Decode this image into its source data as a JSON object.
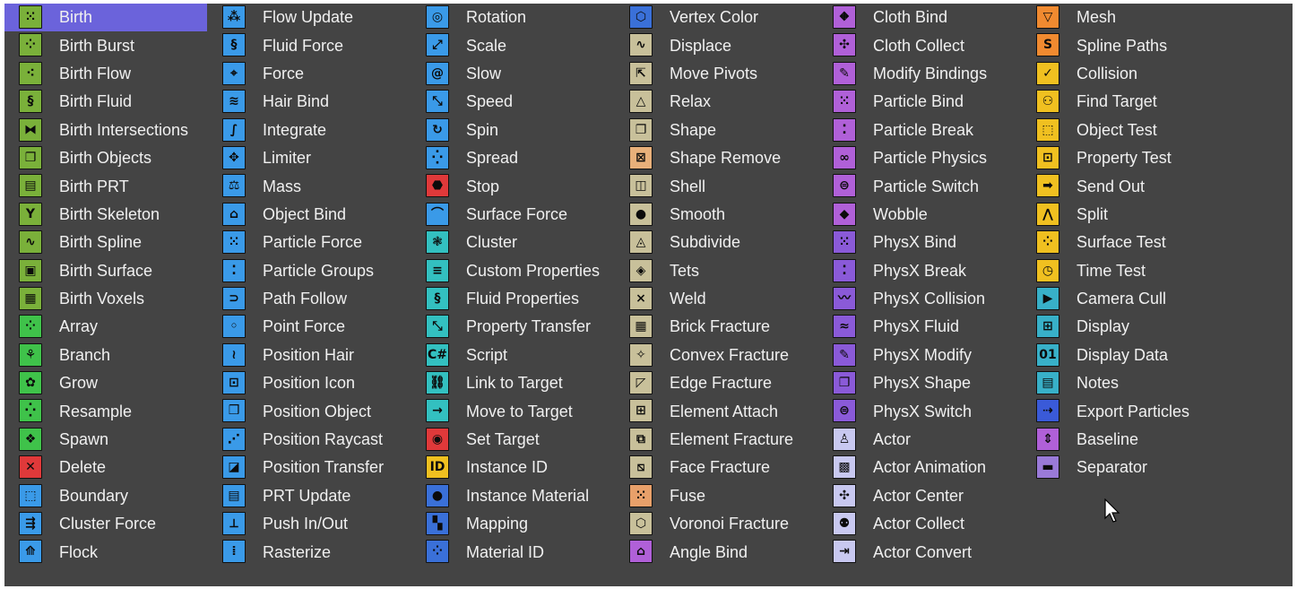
{
  "colors": {
    "panel_bg": "#444444",
    "selection": "#6b63db",
    "text": "#f0f0f0"
  },
  "columns": [
    {
      "color": "#7ab03a",
      "items": [
        {
          "label": "Birth",
          "icon": "birth-icon",
          "glyph": "⁙",
          "selected": true
        },
        {
          "label": "Birth Burst",
          "icon": "birth-burst-icon",
          "glyph": "⁘"
        },
        {
          "label": "Birth Flow",
          "icon": "birth-flow-icon",
          "glyph": "⁖"
        },
        {
          "label": "Birth Fluid",
          "icon": "birth-fluid-icon",
          "glyph": "§"
        },
        {
          "label": "Birth Intersections",
          "icon": "birth-intersections-icon",
          "glyph": "⧓"
        },
        {
          "label": "Birth Objects",
          "icon": "birth-objects-icon",
          "glyph": "❐"
        },
        {
          "label": "Birth PRT",
          "icon": "birth-prt-icon",
          "glyph": "▤"
        },
        {
          "label": "Birth Skeleton",
          "icon": "birth-skeleton-icon",
          "glyph": "Y"
        },
        {
          "label": "Birth Spline",
          "icon": "birth-spline-icon",
          "glyph": "∿"
        },
        {
          "label": "Birth Surface",
          "icon": "birth-surface-icon",
          "glyph": "▣"
        },
        {
          "label": "Birth Voxels",
          "icon": "birth-voxels-icon",
          "glyph": "▦"
        },
        {
          "label": "Array",
          "icon": "array-icon",
          "glyph": "⁘",
          "color": "#3fc24a"
        },
        {
          "label": "Branch",
          "icon": "branch-icon",
          "glyph": "⚘",
          "color": "#3fc24a"
        },
        {
          "label": "Grow",
          "icon": "grow-icon",
          "glyph": "✿",
          "color": "#3fc24a"
        },
        {
          "label": "Resample",
          "icon": "resample-icon",
          "glyph": "⁛",
          "color": "#3fc24a"
        },
        {
          "label": "Spawn",
          "icon": "spawn-icon",
          "glyph": "❖",
          "color": "#3fc24a"
        },
        {
          "label": "Delete",
          "icon": "delete-icon",
          "glyph": "✕",
          "color": "#e0393a"
        },
        {
          "label": "Boundary",
          "icon": "boundary-icon",
          "glyph": "⬚",
          "color": "#3a9ae8"
        },
        {
          "label": "Cluster Force",
          "icon": "cluster-force-icon",
          "glyph": "⇶",
          "color": "#3a9ae8"
        },
        {
          "label": "Flock",
          "icon": "flock-icon",
          "glyph": "⟰",
          "color": "#3a9ae8"
        }
      ]
    },
    {
      "color": "#3a9ae8",
      "items": [
        {
          "label": "Flow Update",
          "icon": "flow-update-icon",
          "glyph": "⁂"
        },
        {
          "label": "Fluid Force",
          "icon": "fluid-force-icon",
          "glyph": "§"
        },
        {
          "label": "Force",
          "icon": "force-icon",
          "glyph": "⌖"
        },
        {
          "label": "Hair Bind",
          "icon": "hair-bind-icon",
          "glyph": "≋"
        },
        {
          "label": "Integrate",
          "icon": "integrate-icon",
          "glyph": "∫"
        },
        {
          "label": "Limiter",
          "icon": "limiter-icon",
          "glyph": "✥"
        },
        {
          "label": "Mass",
          "icon": "mass-icon",
          "glyph": "⚖"
        },
        {
          "label": "Object Bind",
          "icon": "object-bind-icon",
          "glyph": "⌂"
        },
        {
          "label": "Particle Force",
          "icon": "particle-force-icon",
          "glyph": "⁙"
        },
        {
          "label": "Particle Groups",
          "icon": "particle-groups-icon",
          "glyph": "⁚"
        },
        {
          "label": "Path Follow",
          "icon": "path-follow-icon",
          "glyph": "⊃"
        },
        {
          "label": "Point Force",
          "icon": "point-force-icon",
          "glyph": "◦"
        },
        {
          "label": "Position Hair",
          "icon": "position-hair-icon",
          "glyph": "≀"
        },
        {
          "label": "Position Icon",
          "icon": "position-icon-icon",
          "glyph": "⊡"
        },
        {
          "label": "Position Object",
          "icon": "position-object-icon",
          "glyph": "❒"
        },
        {
          "label": "Position Raycast",
          "icon": "position-raycast-icon",
          "glyph": "⋰"
        },
        {
          "label": "Position Transfer",
          "icon": "position-transfer-icon",
          "glyph": "◪"
        },
        {
          "label": "PRT Update",
          "icon": "prt-update-icon",
          "glyph": "▤"
        },
        {
          "label": "Push In/Out",
          "icon": "push-in-out-icon",
          "glyph": "⟂"
        },
        {
          "label": "Rasterize",
          "icon": "rasterize-icon",
          "glyph": "⁞"
        }
      ]
    },
    {
      "color": "#3a9ae8",
      "items": [
        {
          "label": "Rotation",
          "icon": "rotation-icon",
          "glyph": "◎"
        },
        {
          "label": "Scale",
          "icon": "scale-icon",
          "glyph": "⤢"
        },
        {
          "label": "Slow",
          "icon": "slow-icon",
          "glyph": "@"
        },
        {
          "label": "Speed",
          "icon": "speed-icon",
          "glyph": "⤡"
        },
        {
          "label": "Spin",
          "icon": "spin-icon",
          "glyph": "↻"
        },
        {
          "label": "Spread",
          "icon": "spread-icon",
          "glyph": "⁛"
        },
        {
          "label": "Stop",
          "icon": "stop-icon",
          "glyph": "⬣",
          "color": "#e0393a"
        },
        {
          "label": "Surface Force",
          "icon": "surface-force-icon",
          "glyph": "⌒"
        },
        {
          "label": "Cluster",
          "icon": "cluster-icon",
          "glyph": "❃",
          "color": "#33c0c0"
        },
        {
          "label": "Custom Properties",
          "icon": "custom-properties-icon",
          "glyph": "≡",
          "color": "#33c0c0"
        },
        {
          "label": "Fluid Properties",
          "icon": "fluid-properties-icon",
          "glyph": "§",
          "color": "#33c0c0"
        },
        {
          "label": "Property Transfer",
          "icon": "property-transfer-icon",
          "glyph": "⤡",
          "color": "#33c0c0"
        },
        {
          "label": "Script",
          "icon": "script-icon",
          "glyph": "C#",
          "color": "#33c0c0"
        },
        {
          "label": "Link to Target",
          "icon": "link-to-target-icon",
          "glyph": "⛓",
          "color": "#33c0c0"
        },
        {
          "label": "Move to Target",
          "icon": "move-to-target-icon",
          "glyph": "→",
          "color": "#33c0c0"
        },
        {
          "label": "Set Target",
          "icon": "set-target-icon",
          "glyph": "◉",
          "color": "#e0393a"
        },
        {
          "label": "Instance ID",
          "icon": "instance-id-icon",
          "glyph": "ID",
          "color": "#f0c020"
        },
        {
          "label": "Instance Material",
          "icon": "instance-material-icon",
          "glyph": "●",
          "color": "#3a70d8"
        },
        {
          "label": "Mapping",
          "icon": "mapping-icon",
          "glyph": "▚",
          "color": "#3a70d8"
        },
        {
          "label": "Material ID",
          "icon": "material-id-icon",
          "glyph": "⁘",
          "color": "#3a70d8"
        }
      ]
    },
    {
      "color": "#c8c09a",
      "items": [
        {
          "label": "Vertex Color",
          "icon": "vertex-color-icon",
          "glyph": "⬡",
          "color": "#3a70d8"
        },
        {
          "label": "Displace",
          "icon": "displace-icon",
          "glyph": "∿"
        },
        {
          "label": "Move Pivots",
          "icon": "move-pivots-icon",
          "glyph": "⇱"
        },
        {
          "label": "Relax",
          "icon": "relax-icon",
          "glyph": "△"
        },
        {
          "label": "Shape",
          "icon": "shape-icon",
          "glyph": "❐"
        },
        {
          "label": "Shape Remove",
          "icon": "shape-remove-icon",
          "glyph": "⊠",
          "color": "#e8b07a"
        },
        {
          "label": "Shell",
          "icon": "shell-icon",
          "glyph": "◫"
        },
        {
          "label": "Smooth",
          "icon": "smooth-icon",
          "glyph": "●"
        },
        {
          "label": "Subdivide",
          "icon": "subdivide-icon",
          "glyph": "◬"
        },
        {
          "label": "Tets",
          "icon": "tets-icon",
          "glyph": "◈"
        },
        {
          "label": "Weld",
          "icon": "weld-icon",
          "glyph": "⨯"
        },
        {
          "label": "Brick Fracture",
          "icon": "brick-fracture-icon",
          "glyph": "▦"
        },
        {
          "label": "Convex Fracture",
          "icon": "convex-fracture-icon",
          "glyph": "✧"
        },
        {
          "label": "Edge Fracture",
          "icon": "edge-fracture-icon",
          "glyph": "◸"
        },
        {
          "label": "Element Attach",
          "icon": "element-attach-icon",
          "glyph": "⊞"
        },
        {
          "label": "Element Fracture",
          "icon": "element-fracture-icon",
          "glyph": "⧉"
        },
        {
          "label": "Face Fracture",
          "icon": "face-fracture-icon",
          "glyph": "⧅"
        },
        {
          "label": "Fuse",
          "icon": "fuse-icon",
          "glyph": "⁙",
          "color": "#e8a06a"
        },
        {
          "label": "Voronoi Fracture",
          "icon": "voronoi-fracture-icon",
          "glyph": "⬡"
        },
        {
          "label": "Angle Bind",
          "icon": "angle-bind-icon",
          "glyph": "⌂",
          "color": "#b060d8"
        }
      ]
    },
    {
      "color": "#b060d8",
      "items": [
        {
          "label": "Cloth Bind",
          "icon": "cloth-bind-icon",
          "glyph": "⛖"
        },
        {
          "label": "Cloth Collect",
          "icon": "cloth-collect-icon",
          "glyph": "✣"
        },
        {
          "label": "Modify Bindings",
          "icon": "modify-bindings-icon",
          "glyph": "✎"
        },
        {
          "label": "Particle Bind",
          "icon": "particle-bind-icon",
          "glyph": "⁙"
        },
        {
          "label": "Particle Break",
          "icon": "particle-break-icon",
          "glyph": "⁚"
        },
        {
          "label": "Particle Physics",
          "icon": "particle-physics-icon",
          "glyph": "∞"
        },
        {
          "label": "Particle Switch",
          "icon": "particle-switch-icon",
          "glyph": "⊜"
        },
        {
          "label": "Wobble",
          "icon": "wobble-icon",
          "glyph": "◆"
        },
        {
          "label": "PhysX Bind",
          "icon": "physx-bind-icon",
          "glyph": "⁙",
          "color": "#8a5ad8"
        },
        {
          "label": "PhysX Break",
          "icon": "physx-break-icon",
          "glyph": "⁚",
          "color": "#8a5ad8"
        },
        {
          "label": "PhysX Collision",
          "icon": "physx-collision-icon",
          "glyph": "〰",
          "color": "#8a5ad8"
        },
        {
          "label": "PhysX Fluid",
          "icon": "physx-fluid-icon",
          "glyph": "≈",
          "color": "#8a5ad8"
        },
        {
          "label": "PhysX Modify",
          "icon": "physx-modify-icon",
          "glyph": "✎",
          "color": "#8a5ad8"
        },
        {
          "label": "PhysX Shape",
          "icon": "physx-shape-icon",
          "glyph": "❐",
          "color": "#8a5ad8"
        },
        {
          "label": "PhysX Switch",
          "icon": "physx-switch-icon",
          "glyph": "⊜",
          "color": "#8a5ad8"
        },
        {
          "label": "Actor",
          "icon": "actor-icon",
          "glyph": "♙",
          "color": "#c8c8f0"
        },
        {
          "label": "Actor Animation",
          "icon": "actor-animation-icon",
          "glyph": "▩",
          "color": "#c8c8f0"
        },
        {
          "label": "Actor Center",
          "icon": "actor-center-icon",
          "glyph": "✣",
          "color": "#c8c8f0"
        },
        {
          "label": "Actor Collect",
          "icon": "actor-collect-icon",
          "glyph": "⚉",
          "color": "#c8c8f0"
        },
        {
          "label": "Actor Convert",
          "icon": "actor-convert-icon",
          "glyph": "⇥",
          "color": "#c8c8f0"
        }
      ]
    },
    {
      "color": "#f0c020",
      "items": [
        {
          "label": "Mesh",
          "icon": "mesh-icon",
          "glyph": "▽",
          "color": "#f08a30"
        },
        {
          "label": "Spline Paths",
          "icon": "spline-paths-icon",
          "glyph": "S",
          "color": "#f08a30"
        },
        {
          "label": "Collision",
          "icon": "collision-icon",
          "glyph": "✓"
        },
        {
          "label": "Find Target",
          "icon": "find-target-icon",
          "glyph": "⚇"
        },
        {
          "label": "Object Test",
          "icon": "object-test-icon",
          "glyph": "⬚"
        },
        {
          "label": "Property Test",
          "icon": "property-test-icon",
          "glyph": "⊡"
        },
        {
          "label": "Send Out",
          "icon": "send-out-icon",
          "glyph": "➡"
        },
        {
          "label": "Split",
          "icon": "split-icon",
          "glyph": "⋀"
        },
        {
          "label": "Surface Test",
          "icon": "surface-test-icon",
          "glyph": "⁘"
        },
        {
          "label": "Time Test",
          "icon": "time-test-icon",
          "glyph": "◷"
        },
        {
          "label": "Camera Cull",
          "icon": "camera-cull-icon",
          "glyph": "▶",
          "color": "#38b0c8"
        },
        {
          "label": "Display",
          "icon": "display-icon",
          "glyph": "⊞",
          "color": "#38b0c8"
        },
        {
          "label": "Display Data",
          "icon": "display-data-icon",
          "glyph": "01",
          "color": "#38b0c8"
        },
        {
          "label": "Notes",
          "icon": "notes-icon",
          "glyph": "▤",
          "color": "#38b0c8"
        },
        {
          "label": "Export Particles",
          "icon": "export-particles-icon",
          "glyph": "⇢",
          "color": "#3a5ad8"
        },
        {
          "label": "Baseline",
          "icon": "baseline-icon",
          "glyph": "⇕",
          "color": "#b060d8"
        },
        {
          "label": "Separator",
          "icon": "separator-icon",
          "glyph": "▬",
          "color": "#9a7ad8"
        }
      ]
    }
  ]
}
